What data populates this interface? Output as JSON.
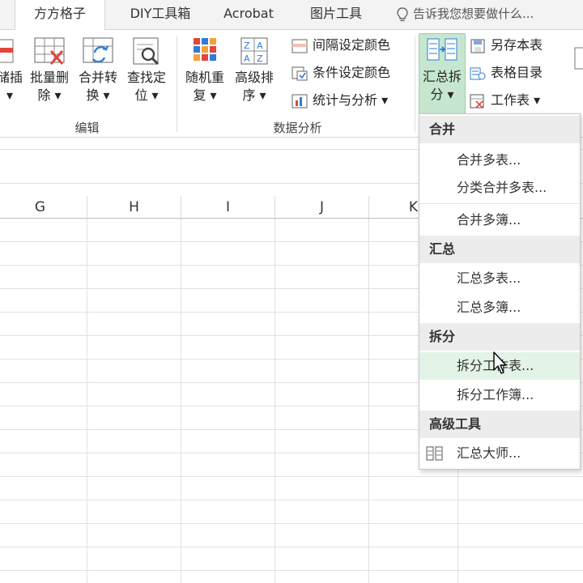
{
  "tabs": [
    "方方格子",
    "DIY工具箱",
    "Acrobat",
    "图片工具"
  ],
  "tell_me": "告诉我您想要做什么...",
  "ribbon": {
    "edit_buttons": [
      {
        "line1": "储插",
        "line2": "▾"
      },
      {
        "line1": "批量删",
        "line2": "除 ▾"
      },
      {
        "line1": "合并转",
        "line2": "换 ▾"
      },
      {
        "line1": "查找定",
        "line2": "位 ▾"
      }
    ],
    "edit_group": "编辑",
    "analysis_buttons": [
      {
        "line1": "随机重",
        "line2": "复 ▾"
      },
      {
        "line1": "高级排",
        "line2": "序 ▾"
      }
    ],
    "analysis_small": [
      "间隔设定颜色",
      "条件设定颜色",
      "统计与分析 ▾"
    ],
    "analysis_group": "数据分析",
    "summary_button": {
      "line1": "汇总拆",
      "line2": "分 ▾"
    },
    "sheet_small": [
      "另存本表",
      "表格目录",
      "工作表 ▾"
    ]
  },
  "columns": [
    "G",
    "H",
    "I",
    "J",
    "K"
  ],
  "menu": {
    "sections": [
      {
        "header": "合并",
        "items": [
          "合并多表...",
          "分类合并多表...",
          "合并多簿..."
        ]
      },
      {
        "header": "汇总",
        "items": [
          "汇总多表...",
          "汇总多簿..."
        ]
      },
      {
        "header": "拆分",
        "items": [
          "拆分工作表...",
          "拆分工作簿..."
        ]
      },
      {
        "header": "高级工具",
        "items": [
          "汇总大师..."
        ]
      }
    ]
  },
  "colors": {
    "accent_green": "#217346",
    "pressed": "#c6e6cf",
    "hover": "#e3f3e7"
  }
}
